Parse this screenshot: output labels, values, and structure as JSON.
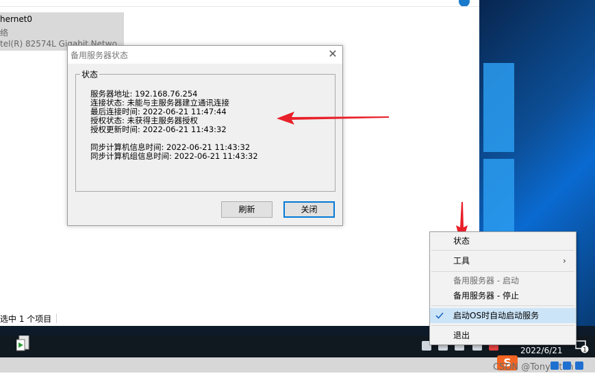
{
  "explorer": {
    "adapter_name": "hernet0",
    "adapter_type": "络",
    "adapter_device": "tel(R) 82574L Gigabit Netwo",
    "status_text": "选中 1 个项目"
  },
  "dialog": {
    "title": "备用服务器状态",
    "close_glyph": "✕",
    "group_label": "状态",
    "lines": [
      "服务器地址: 192.168.76.254",
      "连接状态: 未能与主服务器建立通讯连接",
      "最后连接时间: 2022-06-21 11:47:44",
      "授权状态: 未获得主服务器授权",
      "授权更新时间: 2022-06-21 11:43:32",
      "同步计算机信息时间: 2022-06-21 11:43:32",
      "同步计算机组信息时间: 2022-06-21 11:43:32"
    ],
    "refresh_label": "刷新",
    "close_label": "关闭"
  },
  "context_menu": {
    "items": [
      {
        "label": "状态"
      },
      {
        "label": "工具",
        "submenu_glyph": "›"
      },
      {
        "label": "备用服务器 - 启动"
      },
      {
        "label": "备用服务器 - 停止"
      },
      {
        "label": "启动OS时自动启动服务"
      },
      {
        "label": "退出"
      }
    ]
  },
  "taskbar": {
    "date": "2022/6/21",
    "notification_count": "1"
  },
  "watermark": {
    "text": "CSDN @Tony Stan",
    "logo_letter": "S"
  },
  "colors": {
    "arrow": "#e8202a",
    "menu_checked_bg": "#cce4f7",
    "taskbar": "#101820",
    "accent": "#0078d7"
  },
  "icons": [
    "close-icon",
    "check-icon",
    "chevron-right-icon",
    "app-icon",
    "notification-icon",
    "sogou-logo-icon"
  ]
}
